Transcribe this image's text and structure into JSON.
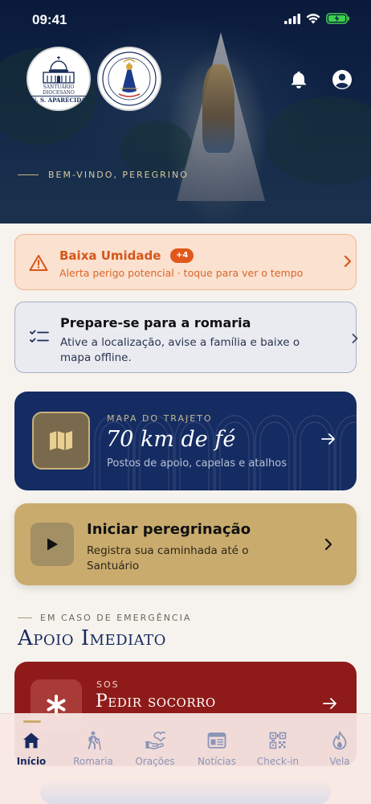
{
  "status_bar": {
    "time": "09:41"
  },
  "header": {
    "logo1_caption_top": "SANTUÁRIO DIOCESANO",
    "logo1_caption_main": "N. S. APARECIDA",
    "welcome": "BEM-VINDO, PEREGRINO"
  },
  "alert": {
    "title": "Baixa Umidade",
    "badge": "+4",
    "subtitle": "Alerta perigo potencial · toque para ver o tempo",
    "color": "#d5561b"
  },
  "prepare": {
    "title": "Prepare-se para a romaria",
    "subtitle": "Ative a localização, avise a família e baixe o mapa offline."
  },
  "route_map": {
    "eyebrow": "MAPA DO TRAJETO",
    "title": "70 km de fé",
    "subtitle": "Postos de apoio, capelas e atalhos"
  },
  "start_pilgrimage": {
    "title": "Iniciar peregrinação",
    "subtitle": "Registra sua caminhada até o Santuário"
  },
  "emergency": {
    "eyebrow": "EM CASO DE EMERGÊNCIA",
    "title": "Apoio Imediato",
    "sos_eyebrow": "SOS",
    "sos_title": "Pedir socorro"
  },
  "tabs": [
    {
      "label": "Início",
      "icon": "home-icon",
      "active": true
    },
    {
      "label": "Romaria",
      "icon": "hiker-icon"
    },
    {
      "label": "Orações",
      "icon": "hands-heart-icon"
    },
    {
      "label": "Notícias",
      "icon": "newspaper-icon"
    },
    {
      "label": "Check-in",
      "icon": "qr-code-icon"
    },
    {
      "label": "Vela",
      "icon": "flame-icon"
    }
  ],
  "colors": {
    "navy": "#172a60",
    "gold": "#c9ab6e",
    "sos_red": "#8e1b19",
    "alert_orange": "#e2571a"
  }
}
